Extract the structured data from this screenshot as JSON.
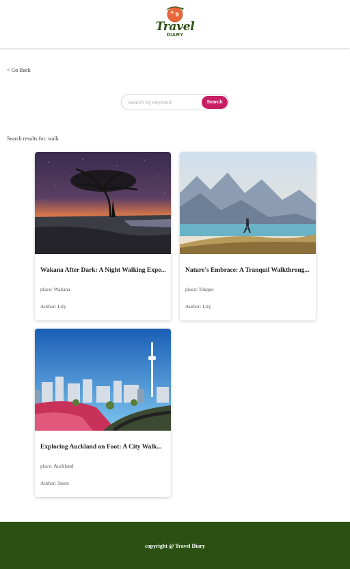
{
  "brand": {
    "name": "Travel",
    "subname": "DIARY"
  },
  "nav": {
    "go_back": "< Go Back"
  },
  "search": {
    "placeholder": "Search by keyword",
    "value": "",
    "button": "Search"
  },
  "results": {
    "label": "Search results for: walk"
  },
  "cards": [
    {
      "title": "Wakana After Dark: A Night Walking Expe...",
      "place": "place: Wakana",
      "author": "Author: Lily"
    },
    {
      "title": "Nature's Embrace: A Tranquil Walkthroug...",
      "place": "place: Tekapo",
      "author": "Author: Lily"
    },
    {
      "title": "Exploring Auckland on Foot: A City Walk...",
      "place": "place: Auckland",
      "author": "Author: Jason"
    }
  ],
  "footer": {
    "copyright": "copyright @ Travel Diary"
  },
  "colors": {
    "brand_green": "#2b5112",
    "search_button": "#c91e63",
    "logo_orange": "#e8673a"
  }
}
